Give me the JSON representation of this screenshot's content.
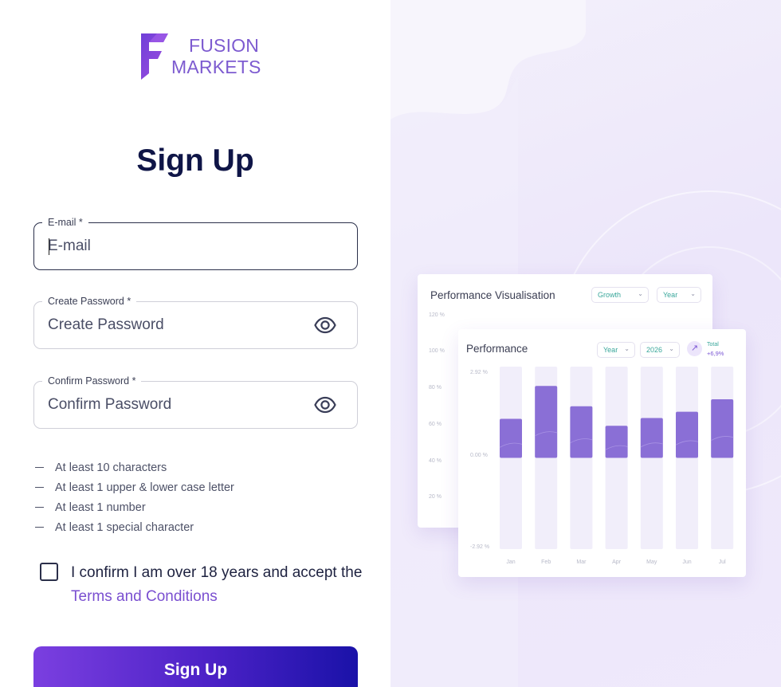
{
  "brand": {
    "line1": "FUSION",
    "line2": "MARKETS",
    "color": "#7d5bd0",
    "icon": "fusion-f-logo-icon"
  },
  "form": {
    "title": "Sign Up",
    "email": {
      "label": "E-mail *",
      "placeholder": "E-mail",
      "value": ""
    },
    "password": {
      "label": "Create Password *",
      "placeholder": "Create Password",
      "value": "",
      "icon": "eye-icon"
    },
    "confirm": {
      "label": "Confirm Password *",
      "placeholder": "Confirm Password",
      "value": "",
      "icon": "eye-icon"
    },
    "rules": [
      "At least 10 characters",
      "At least 1 upper & lower case letter",
      "At least 1 number",
      "At least 1 special character"
    ],
    "consent": {
      "checked": false,
      "text": "I confirm I am over 18 years and accept the ",
      "link": "Terms and Conditions"
    },
    "submit_label": "Sign Up",
    "submit_gradient": [
      "#7b3fe0",
      "#4b21c6",
      "#1a12a8"
    ]
  },
  "preview": {
    "back_card": {
      "title": "Performance Visualisation",
      "filters": [
        "Growth",
        "Year"
      ],
      "y_ticks": [
        "120 %",
        "100 %",
        "80 %",
        "60 %",
        "40 %",
        "20 %"
      ]
    },
    "front_card": {
      "title": "Performance",
      "filters": [
        "Year",
        "2026"
      ],
      "total_label": "Total",
      "total_value": "+6,9%",
      "trend_icon": "arrow-up-right-icon"
    }
  },
  "chart_data": {
    "type": "bar",
    "title": "Performance",
    "categories": [
      "Jan",
      "Feb",
      "Mar",
      "Apr",
      "May",
      "Jun",
      "Jul"
    ],
    "values": [
      2.5,
      4.6,
      3.3,
      2.05,
      2.55,
      2.95,
      3.75
    ],
    "y_tick_labels": [
      "2.92 %",
      "0.00 %",
      "-2.92 %"
    ],
    "ylim": [
      -5.84,
      5.84
    ],
    "bar_color": "#8a6fd6",
    "track_color": "#f1eefa"
  }
}
